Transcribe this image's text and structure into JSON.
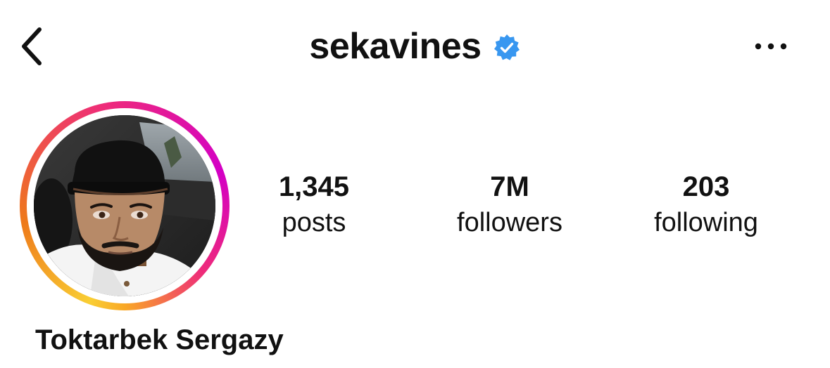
{
  "header": {
    "username": "sekavines",
    "verified": true,
    "back_icon": "chevron-left-icon",
    "more_icon": "ellipsis-icon",
    "verified_icon": "verified-badge-icon",
    "verified_color": "#3897f0"
  },
  "profile": {
    "avatar_ring_colors": [
      "#f9ce34",
      "#ee2a7b",
      "#d300c5"
    ],
    "full_name": "Toktarbek Sergazy"
  },
  "stats": [
    {
      "value": "1,345",
      "label": "posts"
    },
    {
      "value": "7M",
      "label": "followers"
    },
    {
      "value": "203",
      "label": "following"
    }
  ]
}
